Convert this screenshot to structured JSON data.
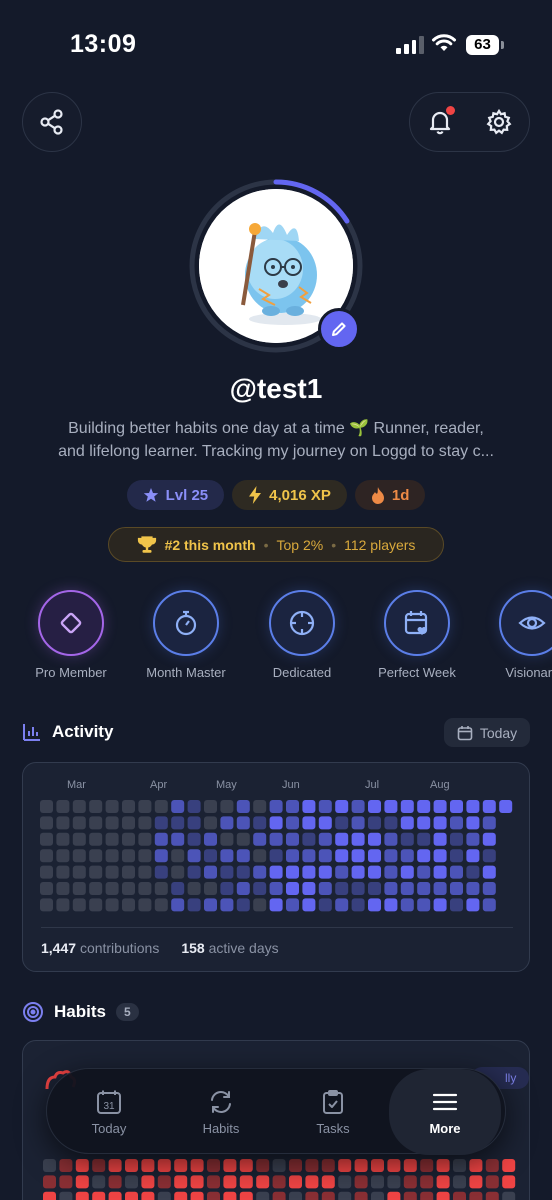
{
  "status_bar": {
    "time": "13:09",
    "battery": "63"
  },
  "profile": {
    "username": "@test1",
    "bio_line1": "Building better habits one day at a time 🌱 Runner, reader,",
    "bio_line2": "and lifelong learner. Tracking my journey on Loggd to stay c...",
    "level_progress": 0.16
  },
  "chips": {
    "level": "Lvl 25",
    "xp": "4,016 XP",
    "streak": "1d"
  },
  "rank": {
    "rank_text": "#2 this month",
    "top_text": "Top 2%",
    "players_text": "112 players"
  },
  "badges": [
    {
      "label": "Pro Member",
      "icon": "diamond-icon"
    },
    {
      "label": "Month Master",
      "icon": "stopwatch-icon"
    },
    {
      "label": "Dedicated",
      "icon": "crosshair-icon"
    },
    {
      "label": "Perfect Week",
      "icon": "calendar-heart-icon"
    },
    {
      "label": "Visionary",
      "icon": "eye-icon"
    }
  ],
  "activity": {
    "title": "Activity",
    "today_button": "Today",
    "months": [
      "Mar",
      "Apr",
      "May",
      "Jun",
      "Jul",
      "Aug"
    ],
    "contributions_value": "1,447",
    "contributions_label": "contributions",
    "active_days_value": "158",
    "active_days_label": "active days"
  },
  "habits": {
    "title": "Habits",
    "count": "5",
    "pill_fragment": "lly"
  },
  "nav": {
    "today": "Today",
    "today_day": "31",
    "habits": "Habits",
    "tasks": "Tasks",
    "more": "More"
  },
  "colors": {
    "accent": "#6366f1",
    "background": "#141a2a",
    "heat_empty": "#3a4050",
    "heat_low": "#38407e",
    "heat_mid": "#4c54b8",
    "heat_high": "#6366f1",
    "habit_done": "#ef4444",
    "habit_partial": "#8a2f34"
  }
}
